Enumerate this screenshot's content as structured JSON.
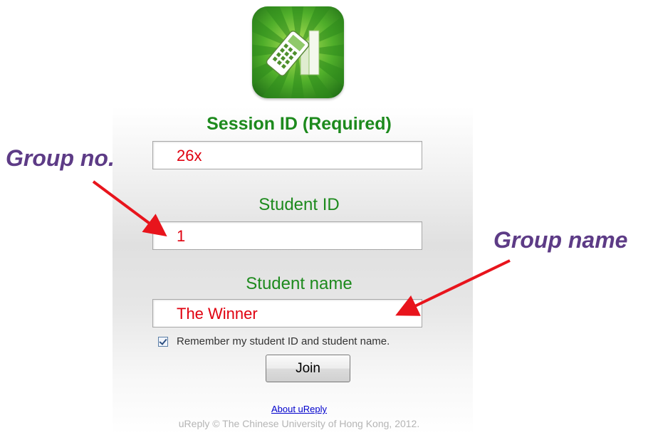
{
  "form": {
    "session_label": "Session ID (Required)",
    "session_value": "26x",
    "student_id_label": "Student ID",
    "student_id_value": "1",
    "student_name_label": "Student name",
    "student_name_value": "The Winner",
    "remember_label": "Remember my student ID and student name.",
    "remember_checked": true,
    "join_label": "Join"
  },
  "footer": {
    "about_link": "About uReply",
    "copyright": "uReply © The Chinese University of Hong Kong, 2012."
  },
  "annotations": {
    "group_no": "Group no.",
    "group_name": "Group name",
    "text_color": "#5d3b86",
    "arrow_color": "#e8141c"
  },
  "colors": {
    "label_green": "#1d8a1d",
    "value_red": "#e0000f"
  },
  "icons": {
    "app_logo": "ureply-logo-icon"
  }
}
